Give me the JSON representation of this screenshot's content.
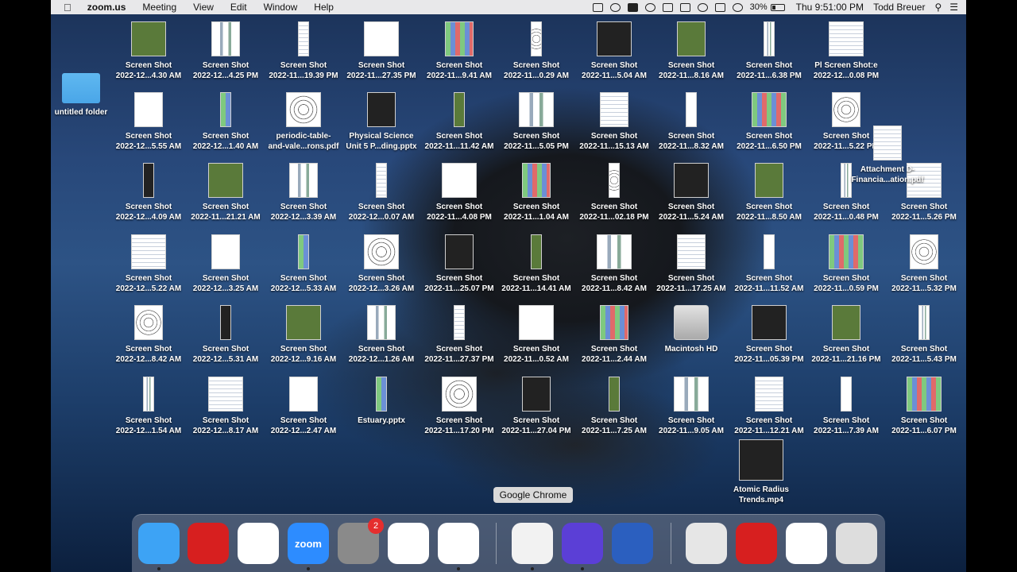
{
  "menubar": {
    "app_name": "zoom.us",
    "menus": [
      "Meeting",
      "View",
      "Edit",
      "Window",
      "Help"
    ],
    "battery_percent": "30%",
    "battery_level": 0.3,
    "clock": "Thu 9:51:00 PM",
    "user": "Todd Breuer"
  },
  "desktop": {
    "folder": "untitled folder",
    "rows": [
      [
        "Screen Shot",
        "2022-12...4.30 AM",
        "Screen Shot",
        "2022-12...4.25 PM",
        "Screen Shot",
        "2022-11...19.39 PM",
        "Screen Shot",
        "2022-11...27.35 PM",
        "Screen Shot",
        "2022-11...9.41 AM",
        "Screen Shot",
        "2022-11...0.29 AM",
        "Screen Shot",
        "2022-11...5.04 AM",
        "Screen Shot",
        "2022-11...8.16 AM",
        "Screen Shot",
        "2022-11...6.38 PM",
        "Pl Screen Shot:e",
        "2022-12...0.08 PM"
      ],
      [
        "Screen Shot",
        "2022-12...5.55 AM",
        "Screen Shot",
        "2022-12...1.40 AM",
        "periodic-table-",
        "and-vale...rons.pdf",
        "Physical Science",
        "Unit 5 P...ding.pptx",
        "Screen Shot",
        "2022-11...11.42 AM",
        "Screen Shot",
        "2022-11...5.05 PM",
        "Screen Shot",
        "2022-11...15.13 AM",
        "Screen Shot",
        "2022-11...8.32 AM",
        "Screen Shot",
        "2022-11...6.50 PM",
        "Screen Shot",
        "2022-11...5.22 PM"
      ],
      [
        "Screen Shot",
        "2022-12...4.09 AM",
        "Screen Shot",
        "2022-11...21.21 AM",
        "Screen Shot",
        "2022-12...3.39 AM",
        "Screen Shot",
        "2022-12...0.07 AM",
        "Screen Shot",
        "2022-11...4.08 PM",
        "Screen Shot",
        "2022-11...1.04 AM",
        "Screen Shot",
        "2022-11...02.18 PM",
        "Screen Shot",
        "2022-11...5.24 AM",
        "Screen Shot",
        "2022-11...8.50 AM",
        "Screen Shot",
        "2022-11...0.48 PM",
        "Screen Shot",
        "2022-11...5.26 PM"
      ],
      [
        "Screen Shot",
        "2022-12...5.22 AM",
        "Screen Shot",
        "2022-12...3.25 AM",
        "Screen Shot",
        "2022-12...5.33 AM",
        "Screen Shot",
        "2022-12...3.26 AM",
        "Screen Shot",
        "2022-11...25.07 PM",
        "Screen Shot",
        "2022-11...14.41 AM",
        "Screen Shot",
        "2022-11...8.42 AM",
        "Screen Shot",
        "2022-11...17.25 AM",
        "Screen Shot",
        "2022-11...11.52 AM",
        "Screen Shot",
        "2022-11...0.59 PM",
        "Screen Shot",
        "2022-11...5.32 PM"
      ],
      [
        "Screen Shot",
        "2022-12...8.42 AM",
        "Screen Shot",
        "2022-12...5.31 AM",
        "Screen Shot",
        "2022-12...9.16 AM",
        "Screen Shot",
        "2022-12...1.26 AM",
        "Screen Shot",
        "2022-11...27.37 PM",
        "Screen Shot",
        "2022-11...0.52 AM",
        "Screen Shot",
        "2022-11...2.44 AM",
        "Macintosh HD",
        "",
        "Screen Shot",
        "2022-11...05.39 PM",
        "Screen Shot",
        "2022-11...21.16 PM",
        "Screen Shot",
        "2022-11...5.43 PM"
      ],
      [
        "Screen Shot",
        "2022-12...1.54 AM",
        "Screen Shot",
        "2022-12...8.17 AM",
        "Screen Shot",
        "2022-12...2.47 AM",
        "Estuary.pptx",
        "",
        "Screen Shot",
        "2022-11...17.20 PM",
        "Screen Shot",
        "2022-11...27.04 PM",
        "Screen Shot",
        "2022-11...7.25 AM",
        "Screen Shot",
        "2022-11...9.05 AM",
        "Screen Shot",
        "2022-11...12.21 AM",
        "Screen Shot",
        "2022-11...7.39 AM",
        "Screen Shot",
        "2022-11...6.07 PM"
      ]
    ],
    "attachment": [
      "Attachment D-",
      "Financia...ation.pdf"
    ],
    "video": [
      "Atomic Radius",
      "Trends.mp4"
    ]
  },
  "tooltip": "Google Chrome",
  "dock": {
    "apps": [
      {
        "name": "finder-icon",
        "color": "#3da3f5"
      },
      {
        "name": "acrobat-icon",
        "color": "#d71f1f"
      },
      {
        "name": "word-icon",
        "color": "#ffffff"
      },
      {
        "name": "zoom-icon",
        "color": "#2d8cff",
        "label": "zoom"
      },
      {
        "name": "system-preferences-icon",
        "color": "#8a8a8a",
        "badge": "2"
      },
      {
        "name": "numbers-icon",
        "color": "#ffffff"
      },
      {
        "name": "powerpoint-icon",
        "color": "#ffffff"
      },
      {
        "name": "chrome-icon",
        "color": "#f2f2f2"
      },
      {
        "name": "imovie-icon",
        "color": "#5b3fd6"
      },
      {
        "name": "quicktime-icon",
        "color": "#2b5fbf"
      },
      {
        "name": "preview-icon",
        "color": "#e6e6e6"
      },
      {
        "name": "acrobat-folder-icon",
        "color": "#d71f1f"
      },
      {
        "name": "screenshot-icon",
        "color": "#ffffff"
      },
      {
        "name": "trash-icon",
        "color": "#dddddd"
      }
    ]
  }
}
